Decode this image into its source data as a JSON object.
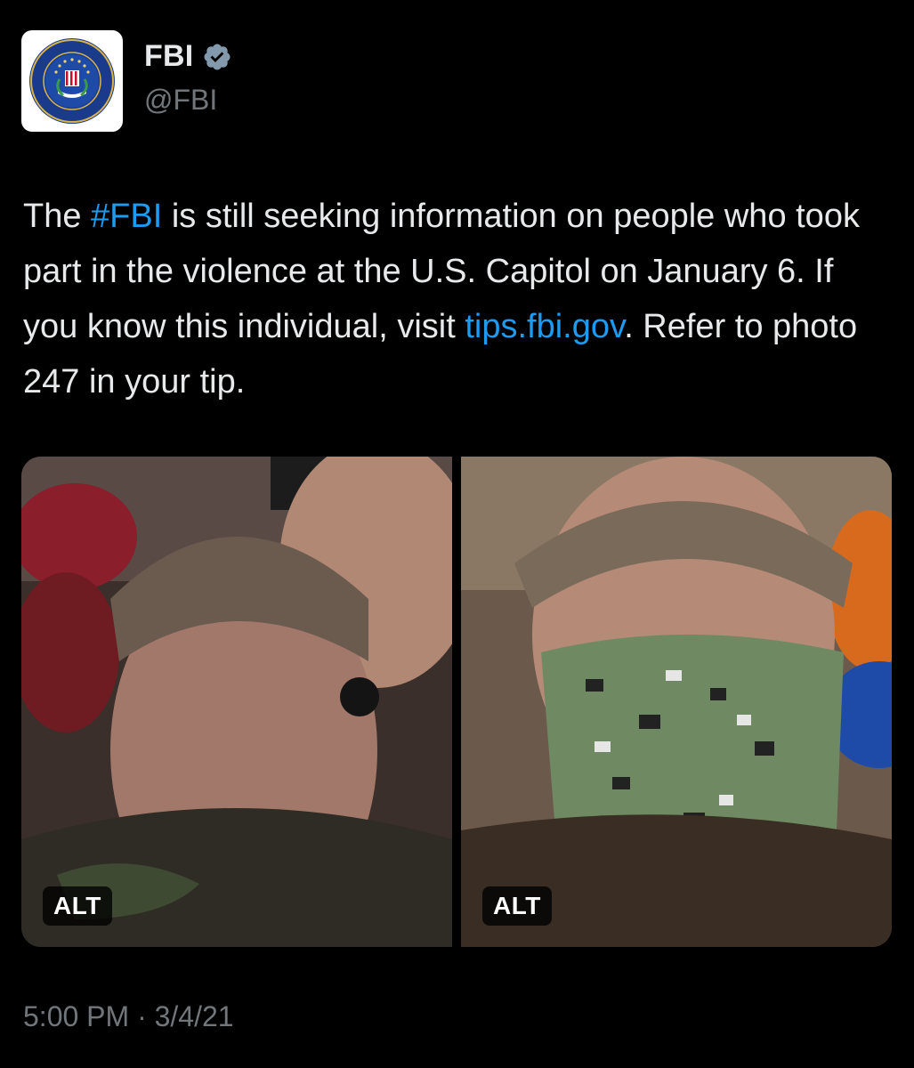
{
  "author": {
    "display_name": "FBI",
    "handle": "@FBI",
    "verified_icon": "verified-badge-icon",
    "avatar": "fbi-seal-logo",
    "seal_text": "DEPARTMENT OF JUSTICE · FEDERAL BUREAU OF INVESTIGATION"
  },
  "tweet": {
    "text_before": "The ",
    "hashtag": "#FBI",
    "text_middle": " is still seeking information on people who took part in the violence at the U.S. Capitol on January 6. If you know this individual, visit ",
    "link": "tips.fbi.gov",
    "text_after": ". Refer to photo 247 in your tip."
  },
  "media": [
    {
      "alt_label": "ALT",
      "description_icon": "photo-man-no-mask"
    },
    {
      "alt_label": "ALT",
      "description_icon": "photo-man-camo-mask"
    }
  ],
  "timestamp": "5:00 PM · 3/4/21",
  "colors": {
    "background": "#000000",
    "text": "#e7e9ea",
    "secondary": "#71767b",
    "link": "#1d9bf0"
  }
}
